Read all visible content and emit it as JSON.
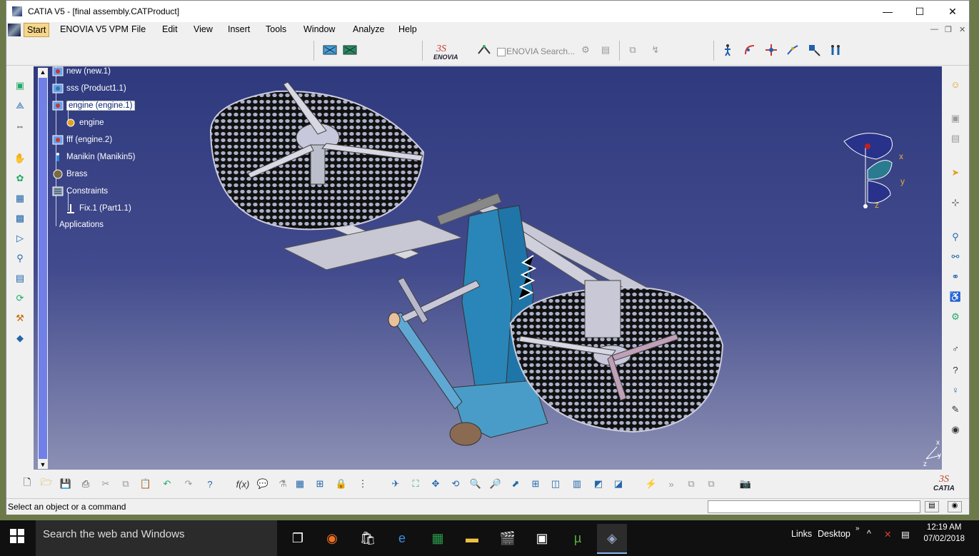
{
  "window": {
    "title": "CATIA V5 - [final assembly.CATProduct]",
    "minimize": "—",
    "maximize": "☐",
    "close": "✕"
  },
  "menubar": {
    "items": [
      "Start",
      "ENOVIA V5 VPM",
      "File",
      "Edit",
      "View",
      "Insert",
      "Tools",
      "Window",
      "Analyze",
      "Help"
    ],
    "active": "Start"
  },
  "toolbar": {
    "enovia_logo": "ENOVIA",
    "enovia_search": "ENOVIA Search..."
  },
  "tree": {
    "items": [
      {
        "label": "new (new.1)"
      },
      {
        "label": "sss (Product1.1)"
      },
      {
        "label": "engine (engine.1)",
        "selected": true
      },
      {
        "label": "engine"
      },
      {
        "label": "fff (engine.2)"
      },
      {
        "label": "Manikin (Manikin5)"
      },
      {
        "label": "Brass"
      },
      {
        "label": "Constraints"
      },
      {
        "label": "Fix.1 (Part1.1)"
      },
      {
        "label": "Applications"
      }
    ]
  },
  "compass": {
    "x": "x",
    "y": "y",
    "z": "z"
  },
  "corner_axes": {
    "x": "x",
    "y": "y",
    "z": "z"
  },
  "catia_logo": "CATIA",
  "status": {
    "message": "Select an object or a command"
  },
  "taskbar": {
    "search_placeholder": "Search the web and Windows",
    "links": "Links",
    "desktop": "Desktop",
    "time": "12:19 AM",
    "date": "07/02/2018"
  },
  "colors": {
    "viewport_top": "#2f3a7e",
    "viewport_bottom": "#8c90b4",
    "manikin_blue": "#2a86b8",
    "tree_scroll": "#7080e8"
  }
}
